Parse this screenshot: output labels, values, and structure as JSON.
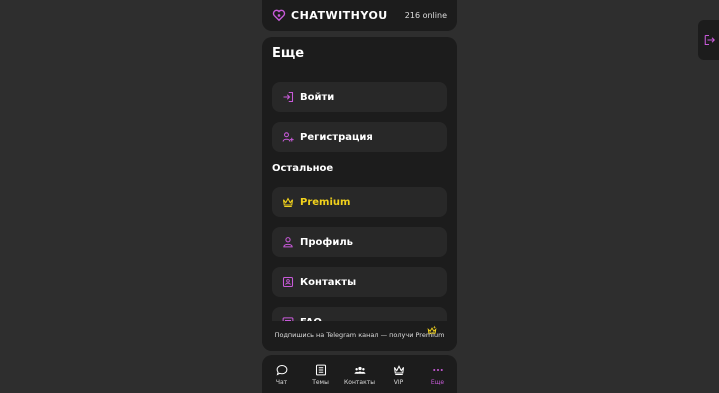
{
  "header": {
    "brand": "CHATWITHYOU",
    "online": "216 online"
  },
  "panel": {
    "title": "Еще",
    "auth_items": [
      {
        "label": "Войти",
        "icon": "login-icon"
      },
      {
        "label": "Регистрация",
        "icon": "add-user-icon"
      }
    ],
    "section_title": "Остальное",
    "other_items": [
      {
        "label": "Premium",
        "icon": "crown-icon"
      },
      {
        "label": "Профиль",
        "icon": "user-icon"
      },
      {
        "label": "Контакты",
        "icon": "contacts-icon"
      },
      {
        "label": "FAQ",
        "icon": "faq-icon"
      }
    ],
    "promo": "Подпишись на Telegram канал — получи Premium"
  },
  "nav": [
    {
      "label": "Чат",
      "icon": "chat-bubble-icon"
    },
    {
      "label": "Темы",
      "icon": "list-icon"
    },
    {
      "label": "Контакты",
      "icon": "group-icon"
    },
    {
      "label": "VIP",
      "icon": "crown-icon"
    },
    {
      "label": "Еще",
      "icon": "more-icon",
      "active": true
    }
  ],
  "colors": {
    "accent": "#c85ad9",
    "premium": "#f2d21c",
    "background": "#2e2e2e",
    "surface": "#1c1c1c",
    "item": "#282828"
  }
}
